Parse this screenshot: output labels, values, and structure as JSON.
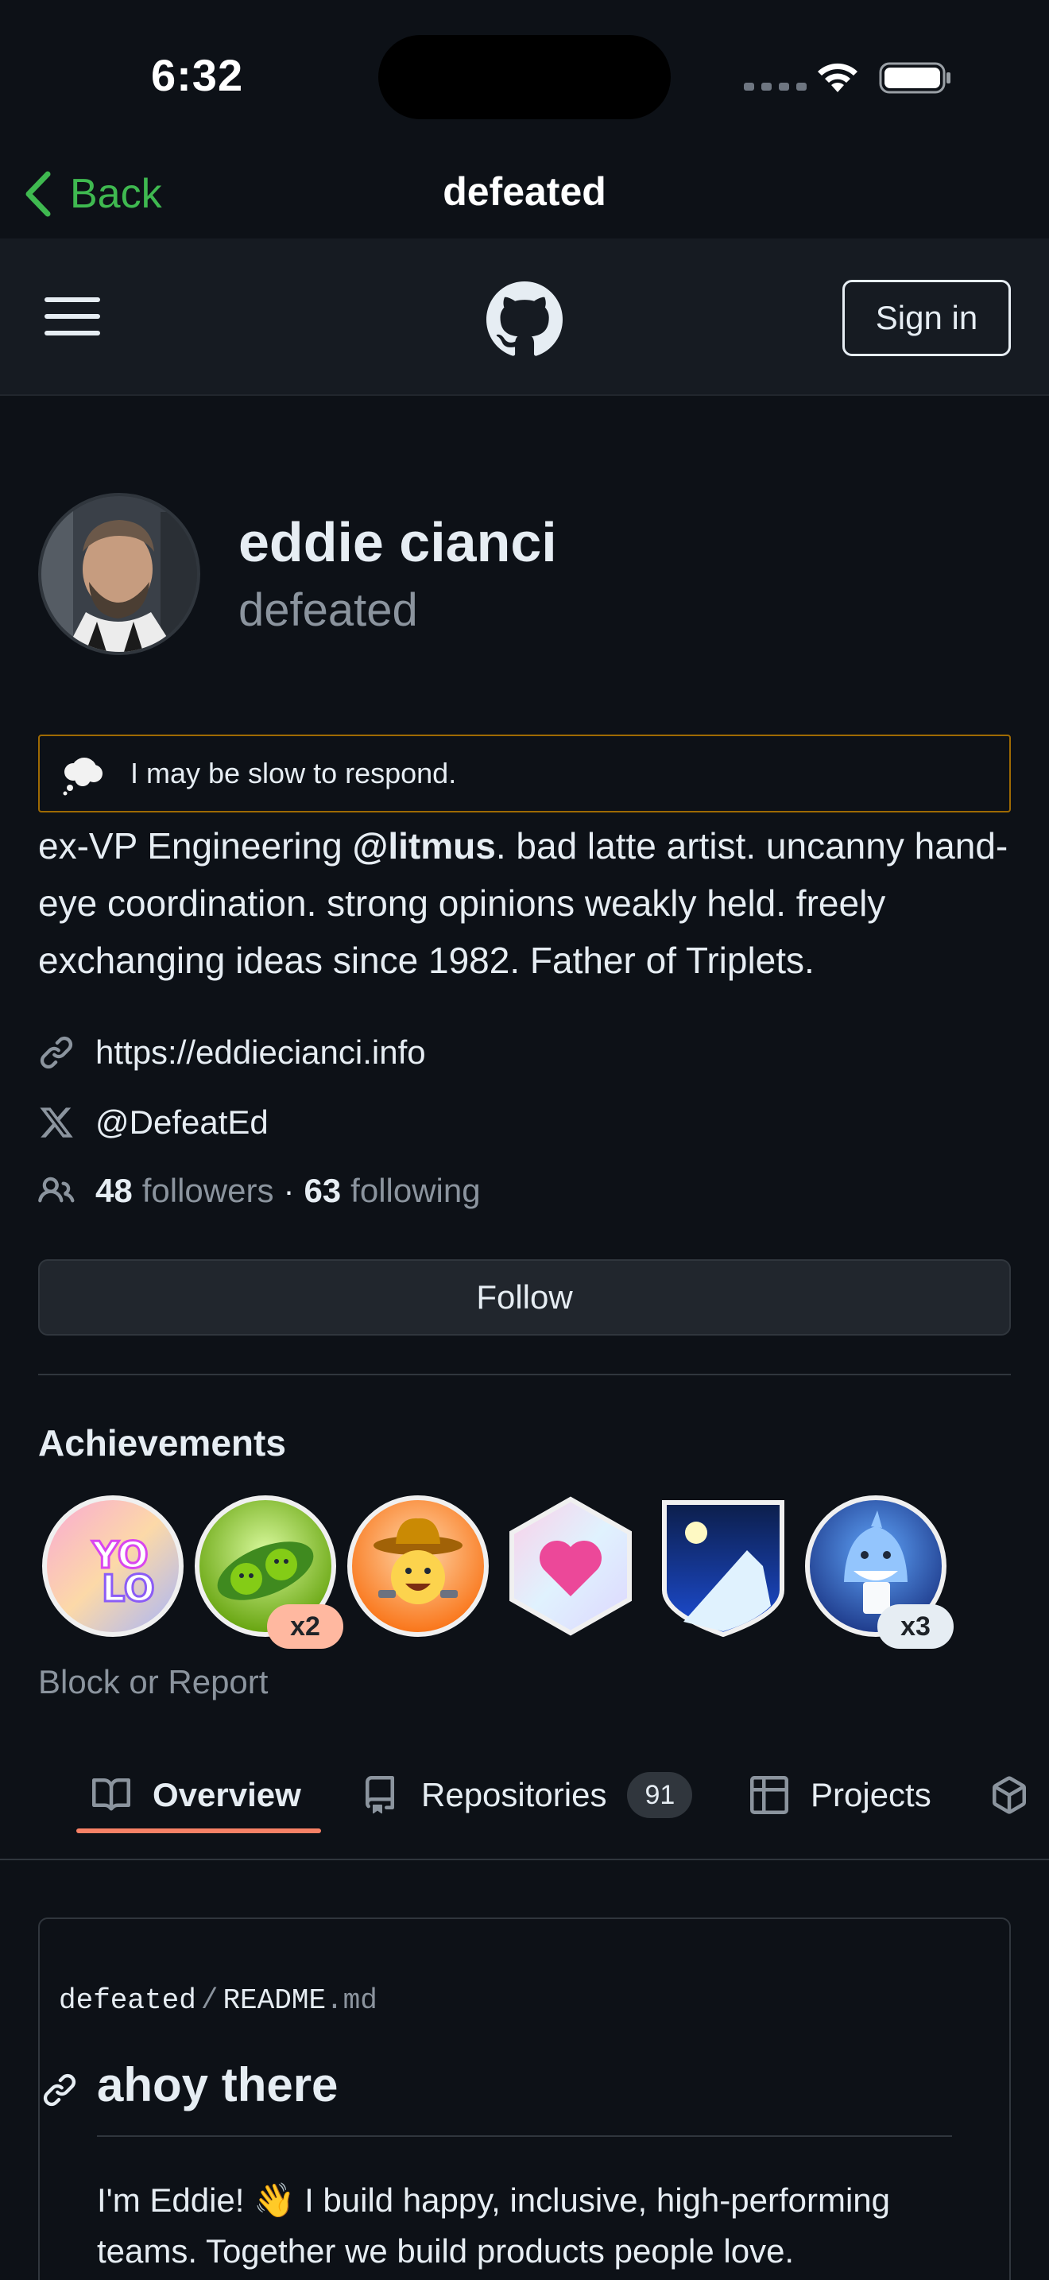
{
  "status_bar": {
    "time": "6:32"
  },
  "nav": {
    "back_label": "Back",
    "title": "defeated"
  },
  "header": {
    "sign_in_label": "Sign in"
  },
  "profile": {
    "name": "eddie cianci",
    "login": "defeated",
    "status": {
      "emoji": "thought-balloon",
      "text": "I may be slow to respond."
    },
    "bio_before": "ex-VP Engineering ",
    "bio_mention": "@litmus",
    "bio_after": ". bad latte artist. uncanny hand-eye coordination. strong opinions weakly held. freely exchanging ideas since 1982. Father of Triplets.",
    "website": "https://eddiecianci.info",
    "twitter": "@DefeatEd",
    "followers_count": "48",
    "followers_label": "followers",
    "separator": "·",
    "following_count": "63",
    "following_label": "following",
    "follow_button": "Follow"
  },
  "achievements": {
    "title": "Achievements",
    "badges": [
      {
        "name": "yolo",
        "count": ""
      },
      {
        "name": "pair-extraordinaire",
        "count": "x2"
      },
      {
        "name": "quickdraw",
        "count": ""
      },
      {
        "name": "public-sponsor",
        "count": ""
      },
      {
        "name": "arctic-code-vault-contributor",
        "count": ""
      },
      {
        "name": "pull-shark",
        "count": "x3"
      }
    ],
    "block_report": "Block or Report"
  },
  "tabs": [
    {
      "label": "Overview",
      "icon": "book-icon",
      "selected": true
    },
    {
      "label": "Repositories",
      "icon": "repo-icon",
      "count": "91"
    },
    {
      "label": "Projects",
      "icon": "table-icon"
    },
    {
      "label": "",
      "icon": "package-icon"
    }
  ],
  "readme": {
    "owner": "defeated",
    "separator": "/",
    "file": "README",
    "ext": ".md",
    "heading": "ahoy there",
    "paragraph": "I'm Eddie! 👋 I build happy, inclusive, high-performing teams. Together we build products people love."
  },
  "colors": {
    "background": "#0d1117",
    "header": "#161b22",
    "accent_green": "#3fb950",
    "tab_underline": "#f78166",
    "status_border": "#9e6a03",
    "muted_text": "#8b949e"
  }
}
